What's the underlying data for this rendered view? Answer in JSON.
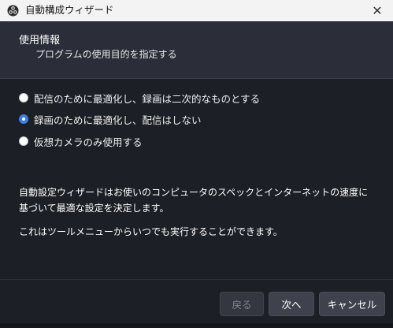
{
  "window": {
    "title": "自動構成ウィザード",
    "close_glyph": "✕"
  },
  "header": {
    "title": "使用情報",
    "subtitle": "プログラムの使用目的を指定する"
  },
  "options": [
    {
      "label": "配信のために最適化し、録画は二次的なものとする",
      "checked": false
    },
    {
      "label": "録画のために最適化し、配信はしない",
      "checked": true
    },
    {
      "label": "仮想カメラのみ使用する",
      "checked": false
    }
  ],
  "description": {
    "paragraph1": "自動設定ウィザードはお使いのコンピュータのスペックとインターネットの速度に基づいて最適な設定を決定します。",
    "paragraph2": "これはツールメニューからいつでも実行することができます。"
  },
  "buttons": {
    "back": "戻る",
    "next": "次へ",
    "cancel": "キャンセル"
  },
  "colors": {
    "background": "#1d1f26",
    "header": "#2b2e38",
    "accent": "#3c7fdf"
  },
  "icons": {
    "app": "obs-logo-icon",
    "close": "close-icon"
  }
}
